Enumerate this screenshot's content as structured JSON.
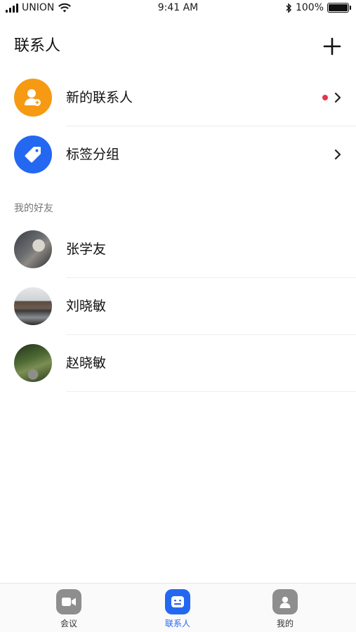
{
  "status_bar": {
    "carrier": "UNION",
    "time": "9:41 AM",
    "battery": "100%",
    "battery_level": 1.0
  },
  "header": {
    "title": "联系人",
    "add_icon": "plus-icon"
  },
  "menu": [
    {
      "label": "新的联系人",
      "icon": "add-contact-icon",
      "icon_bg": "#F59A12",
      "has_badge": true,
      "badge_color": "#E8344E"
    },
    {
      "label": "标签分组",
      "icon": "tag-icon",
      "icon_bg": "#2468F2",
      "has_badge": false
    }
  ],
  "friends_section": {
    "title": "我的好友",
    "friends": [
      {
        "name": "张学友"
      },
      {
        "name": "刘晓敏"
      },
      {
        "name": "赵晓敏"
      }
    ]
  },
  "tab_bar": {
    "tabs": [
      {
        "label": "会议",
        "icon": "video-icon",
        "active": false
      },
      {
        "label": "联系人",
        "icon": "contacts-icon",
        "active": true
      },
      {
        "label": "我的",
        "icon": "profile-icon",
        "active": false
      }
    ],
    "active_color": "#2468F2",
    "inactive_color": "#333333"
  }
}
